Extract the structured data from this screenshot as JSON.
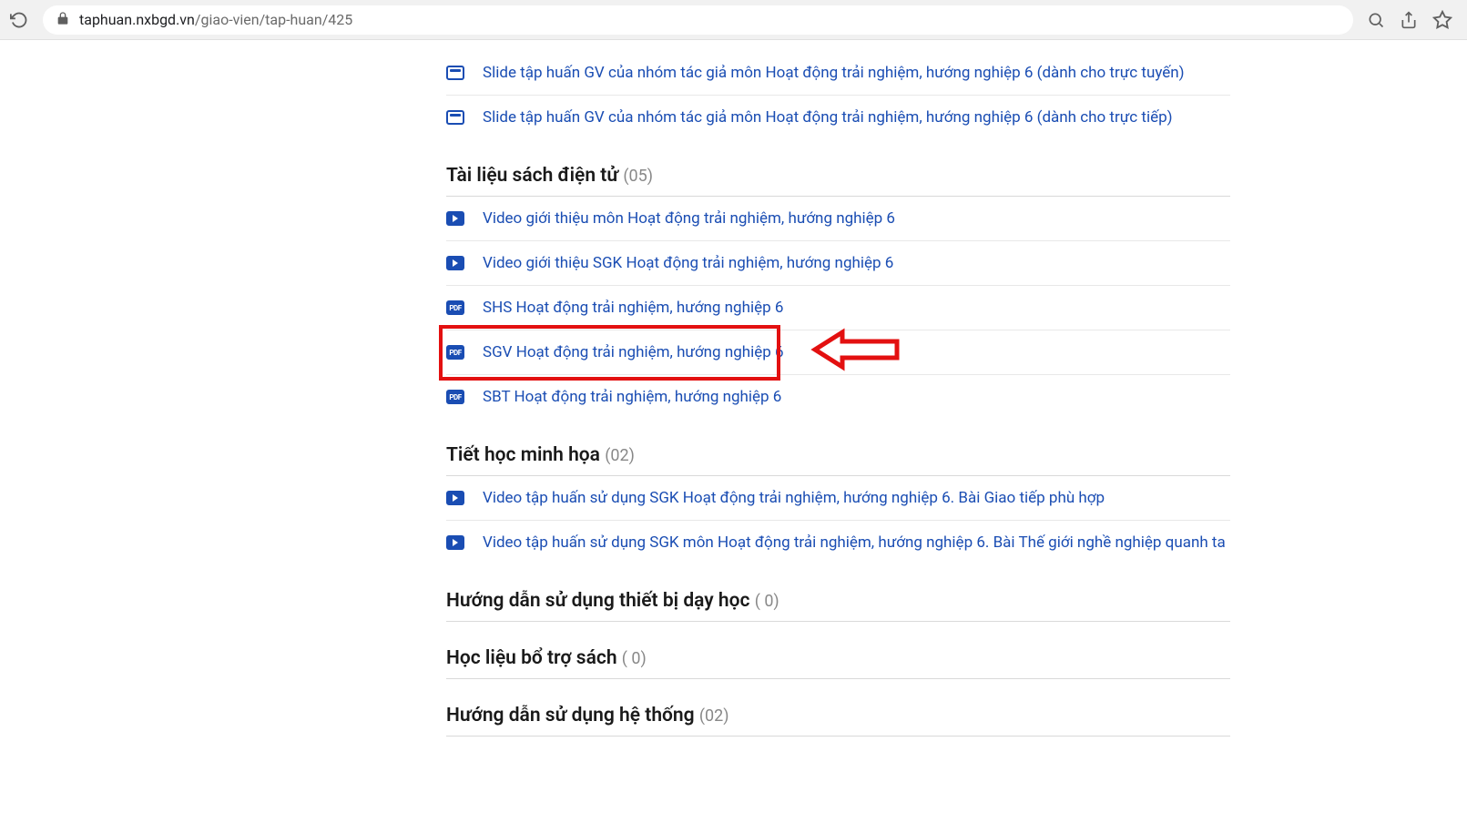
{
  "browser": {
    "url_host": "taphuan.nxbgd.vn",
    "url_path": "/giao-vien/tap-huan/425"
  },
  "sections": [
    {
      "title": "",
      "count": "",
      "items": [
        {
          "icon": "slide",
          "label": "Slide tập huấn GV của nhóm tác giả môn Hoạt động trải nghiệm, hướng nghiệp 6 (dành cho trực tuyến)"
        },
        {
          "icon": "slide",
          "label": "Slide tập huấn GV của nhóm tác giả môn Hoạt động trải nghiệm, hướng nghiệp 6 (dành cho trực tiếp)"
        }
      ]
    },
    {
      "title": "Tài liệu sách điện tử",
      "count": "(05)",
      "items": [
        {
          "icon": "video",
          "label": "Video giới thiệu môn Hoạt động trải nghiệm, hướng nghiệp 6"
        },
        {
          "icon": "video",
          "label": "Video giới thiệu SGK Hoạt động trải nghiệm, hướng nghiệp 6"
        },
        {
          "icon": "pdf",
          "label": "SHS Hoạt động trải nghiệm, hướng nghiệp 6"
        },
        {
          "icon": "pdf",
          "label": "SGV Hoạt động trải nghiệm, hướng nghiệp 6"
        },
        {
          "icon": "pdf",
          "label": "SBT Hoạt động trải nghiệm, hướng nghiệp 6"
        }
      ]
    },
    {
      "title": "Tiết học minh họa",
      "count": "(02)",
      "items": [
        {
          "icon": "video",
          "label": "Video tập huấn sử dụng SGK Hoạt động trải nghiệm, hướng nghiệp 6. Bài Giao tiếp phù hợp"
        },
        {
          "icon": "video",
          "label": "Video tập huấn sử dụng SGK môn Hoạt động trải nghiệm, hướng nghiệp 6. Bài Thế giới nghề nghiệp quanh ta"
        }
      ]
    },
    {
      "title": "Hướng dẫn sử dụng thiết bị dạy học",
      "count": "( 0)",
      "items": []
    },
    {
      "title": "Học liệu bổ trợ sách",
      "count": "( 0)",
      "items": []
    },
    {
      "title": "Hướng dẫn sử dụng hệ thống",
      "count": "(02)",
      "items": []
    }
  ],
  "pdf_text": "PDF",
  "annotation": {
    "highlight_section_index": 1,
    "highlight_item_index": 3
  }
}
